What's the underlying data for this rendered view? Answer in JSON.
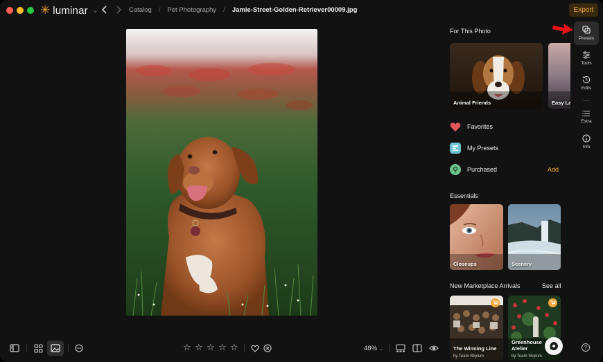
{
  "app": {
    "name": "luminar",
    "accent_color": "#f4ad3b"
  },
  "breadcrumb": {
    "items": [
      "Catalog",
      "Pet Photography"
    ],
    "current_file": "Jamie-Street-Golden-Retriever00009.jpg"
  },
  "header": {
    "export_label": "Export"
  },
  "icons": {
    "app_menu": "chevron-down-icon",
    "back": "chevron-left-icon",
    "forward": "chevron-right-icon"
  },
  "rail": {
    "items": [
      {
        "id": "presets",
        "label": "Presets",
        "active": true
      },
      {
        "id": "tools",
        "label": "Tools",
        "active": false
      },
      {
        "id": "edits",
        "label": "Edits",
        "active": false
      },
      {
        "id": "extra",
        "label": "Extra",
        "active": false
      },
      {
        "id": "info",
        "label": "Info",
        "active": false
      }
    ]
  },
  "panel": {
    "for_this_photo": {
      "title": "For This Photo",
      "cards": [
        {
          "label": "Animal Friends"
        },
        {
          "label": "Easy La"
        }
      ]
    },
    "collections": [
      {
        "label": "Favorites",
        "icon": "heart-icon",
        "color": "#e0575b"
      },
      {
        "label": "My Presets",
        "icon": "presets-icon",
        "color": "#6fc2d6"
      },
      {
        "label": "Purchased",
        "icon": "purchased-icon",
        "color": "#6dc28a",
        "action": "Add"
      }
    ],
    "essentials": {
      "title": "Essentials",
      "cards": [
        {
          "label": "Closeups"
        },
        {
          "label": "Scenery"
        }
      ]
    },
    "marketplace": {
      "title": "New Marketplace Arrivals",
      "see_all": "See all",
      "cards": [
        {
          "label": "The Winning Line",
          "author": "by Team Skylum"
        },
        {
          "label": "Greenhouse Atelier",
          "author": "by Team Skylum"
        }
      ]
    }
  },
  "bottom_bar": {
    "zoom": "48%",
    "rating_stars": 5
  }
}
